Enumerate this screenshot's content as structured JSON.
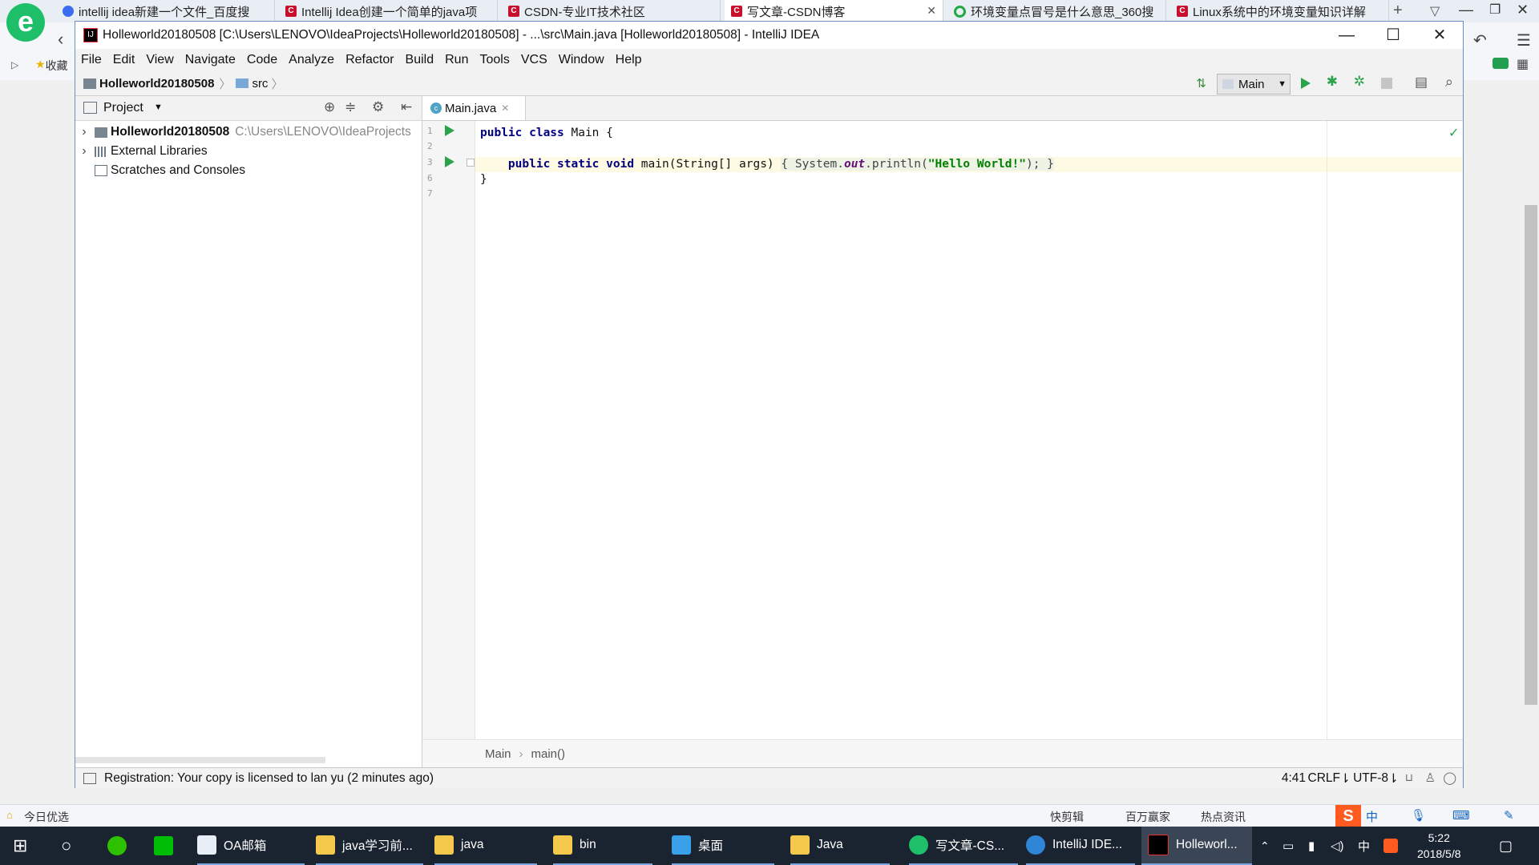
{
  "browser": {
    "tabs": [
      {
        "label": "intellij idea新建一个文件_百度搜",
        "icon": "paw-icon",
        "x": 0
      },
      {
        "label": "Intellij Idea创建一个简单的java项",
        "icon": "csdn-icon"
      },
      {
        "label": "CSDN-专业IT技术社区",
        "icon": "csdn-icon"
      },
      {
        "label": "写文章-CSDN博客",
        "icon": "csdn-icon"
      },
      {
        "label": "环境变量点冒号是什么意思_360搜",
        "icon": "search360-icon"
      },
      {
        "label": "Linux系统中的环境变量知识详解",
        "icon": "csdn-icon"
      }
    ],
    "new_tab": "+",
    "bookmark_label": "收藏",
    "status_left": "今日优选",
    "status_right": [
      "快剪辑",
      "百万赢家",
      "热点资讯"
    ]
  },
  "ide": {
    "window_title": "Holleworld20180508 [C:\\Users\\LENOVO\\IdeaProjects\\Holleworld20180508] - ...\\src\\Main.java [Holleworld20180508] - IntelliJ IDEA",
    "menu": [
      "File",
      "Edit",
      "View",
      "Navigate",
      "Code",
      "Analyze",
      "Refactor",
      "Build",
      "Run",
      "Tools",
      "VCS",
      "Window",
      "Help"
    ],
    "breadcrumb": {
      "project": "Holleworld20180508",
      "folder": "src"
    },
    "run_config": "Main",
    "project_panel": {
      "title": "Project",
      "items": [
        {
          "label": "Holleworld20180508",
          "path": "C:\\Users\\LENOVO\\IdeaProjects"
        },
        {
          "label": "External Libraries"
        },
        {
          "label": "Scratches and Consoles"
        }
      ]
    },
    "editor": {
      "tab": "Main.java",
      "line_numbers": [
        "1",
        "2",
        "3",
        "6",
        "7"
      ],
      "code_crumbs": [
        "Main",
        "main()"
      ]
    },
    "status": {
      "message": "Registration: Your copy is licensed to lan yu (2 minutes ago)",
      "position": "4:41",
      "line_sep": "CRLF",
      "encoding": "UTF-8"
    }
  },
  "taskbar": {
    "items": [
      "OA邮箱",
      "java学习前...",
      "java",
      "bin",
      "桌面",
      "Java",
      "写文章-CS...",
      "IntelliJ IDE...",
      "Holleworl..."
    ],
    "ime": "中",
    "time": "5:22",
    "date": "2018/5/8"
  }
}
